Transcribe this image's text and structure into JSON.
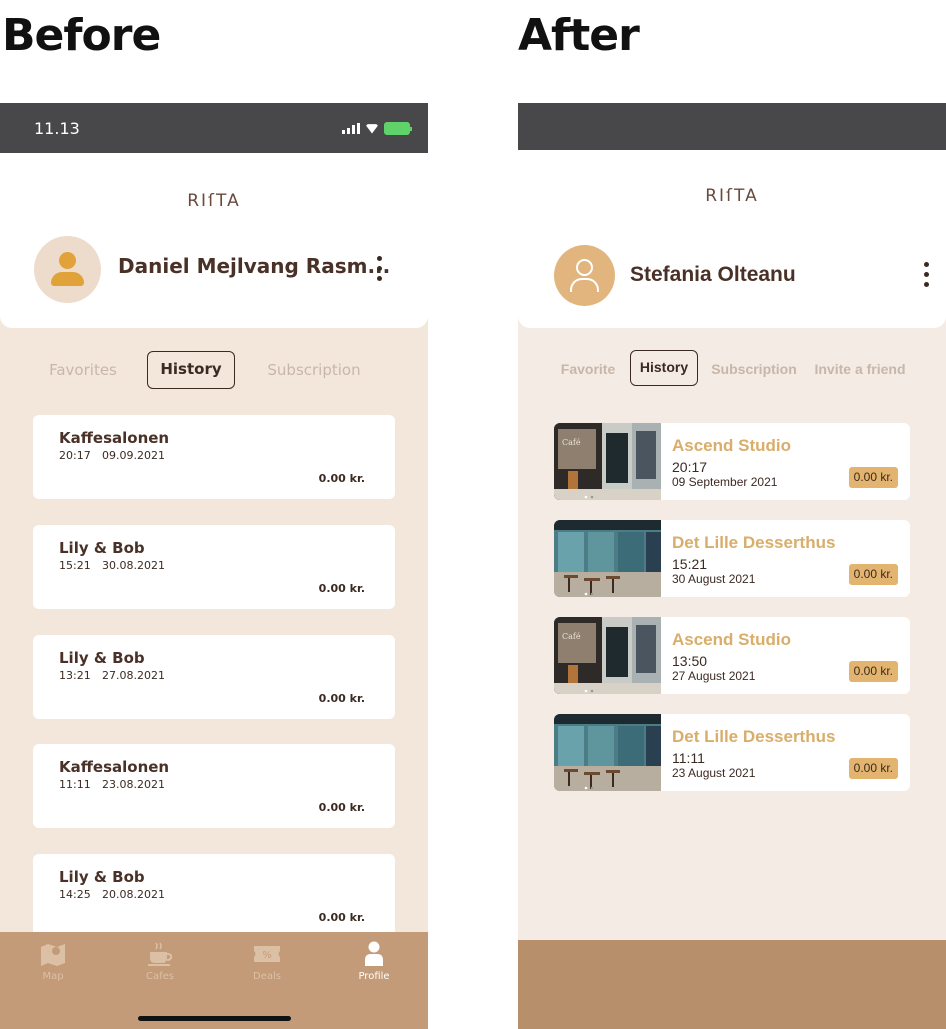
{
  "before": {
    "heading": "Before",
    "status_time": "11.13",
    "logo": "RIſTA",
    "username": "Daniel Mejlvang Rasm...",
    "tabs": [
      {
        "label": "Favorites",
        "active": false
      },
      {
        "label": "History",
        "active": true
      },
      {
        "label": "Subscription",
        "active": false
      }
    ],
    "history": [
      {
        "name": "Kaffesalonen",
        "time": "20:17",
        "date": "09.09.2021",
        "price": "0.00 kr."
      },
      {
        "name": "Lily & Bob",
        "time": "15:21",
        "date": "30.08.2021",
        "price": "0.00 kr."
      },
      {
        "name": "Lily & Bob",
        "time": "13:21",
        "date": "27.08.2021",
        "price": "0.00 kr."
      },
      {
        "name": "Kaffesalonen",
        "time": "11:11",
        "date": "23.08.2021",
        "price": "0.00 kr."
      },
      {
        "name": "Lily & Bob",
        "time": "14:25",
        "date": "20.08.2021",
        "price": "0.00 kr."
      }
    ],
    "nav": [
      {
        "label": "Map",
        "icon": "map-icon",
        "active": false
      },
      {
        "label": "Cafes",
        "icon": "coffee-cup-icon",
        "active": false
      },
      {
        "label": "Deals",
        "icon": "ticket-icon",
        "active": false
      },
      {
        "label": "Profile",
        "icon": "person-icon",
        "active": true
      }
    ],
    "colors": {
      "background": "#f3e7dc",
      "nav": "#c39b78",
      "avatar_icon": "#e2a23a",
      "text": "#4a3127"
    }
  },
  "after": {
    "heading": "After",
    "logo": "RIſTA",
    "username": "Stefania Olteanu",
    "tabs": [
      {
        "label": "Favorite",
        "active": false
      },
      {
        "label": "History",
        "active": true
      },
      {
        "label": "Subscription",
        "active": false
      },
      {
        "label": "Invite a friend",
        "active": false
      }
    ],
    "history": [
      {
        "name": "Ascend Studio",
        "time": "20:17",
        "date": "09 September 2021",
        "price": "0.00 kr.",
        "thumb": "cafe-storefront-image"
      },
      {
        "name": "Det Lille Desserthus",
        "time": "15:21",
        "date": "30 August 2021",
        "price": "0.00 kr.",
        "thumb": "cafe-terrace-image"
      },
      {
        "name": "Ascend Studio",
        "time": "13:50",
        "date": "27 August 2021",
        "price": "0.00 kr.",
        "thumb": "cafe-storefront-image"
      },
      {
        "name": "Det Lille Desserthus",
        "time": "11:11",
        "date": "23 August 2021",
        "price": "0.00 kr.",
        "thumb": "cafe-terrace-image"
      }
    ],
    "colors": {
      "background": "#f4ebe4",
      "nav": "#b78f6b",
      "accent": "#d9ad6a",
      "price_badge": "#e3b46f",
      "avatar": "#e2b57e"
    }
  }
}
